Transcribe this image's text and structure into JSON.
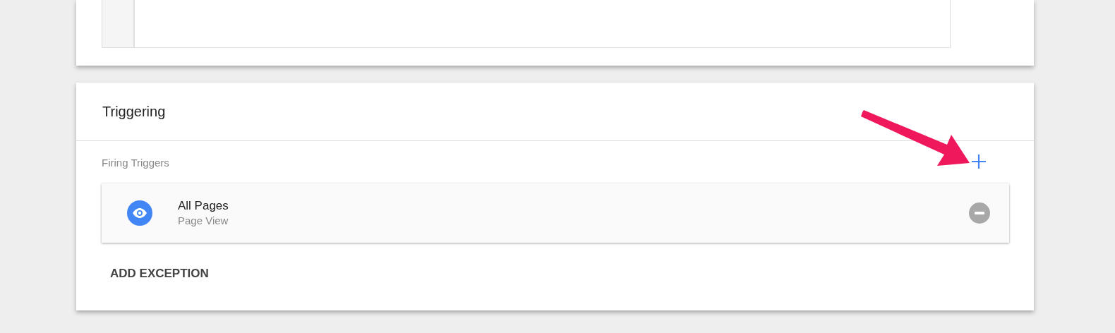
{
  "section": {
    "title": "Triggering",
    "subtitle": "Firing Triggers"
  },
  "triggers": [
    {
      "name": "All Pages",
      "type": "Page View"
    }
  ],
  "add_exception_button": "ADD EXCEPTION"
}
